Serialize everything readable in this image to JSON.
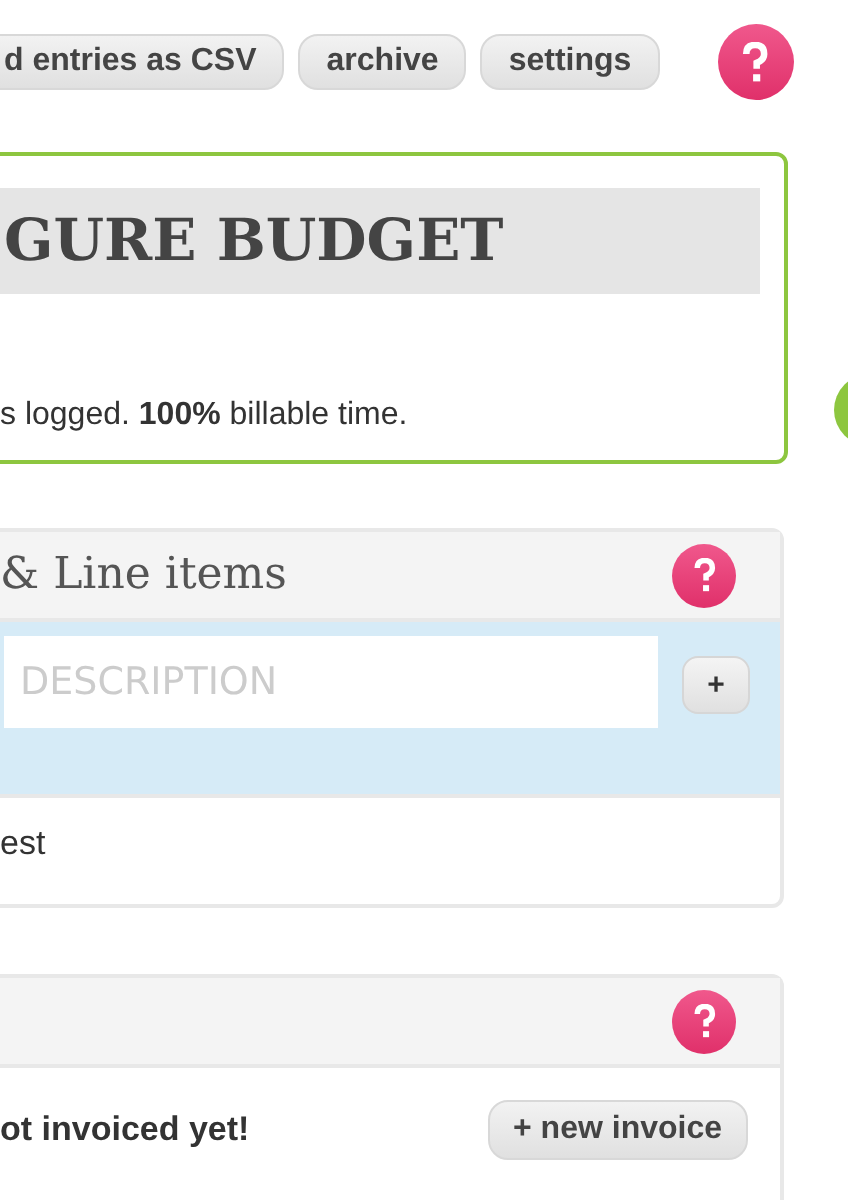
{
  "toolbar": {
    "buttons": [
      "d entries as CSV",
      "archive",
      "settings"
    ]
  },
  "budget_card": {
    "title": "GURE BUDGET",
    "summary": "s logged. **100%** billable time."
  },
  "line_items_panel": {
    "title": "& Line items",
    "description": {
      "placeholder": "DESCRIPTION"
    },
    "add_button": "+",
    "rows": [
      "est"
    ]
  },
  "invoices_panel": {
    "message": "ot invoiced yet!",
    "new_invoice_button": "+ new invoice"
  }
}
